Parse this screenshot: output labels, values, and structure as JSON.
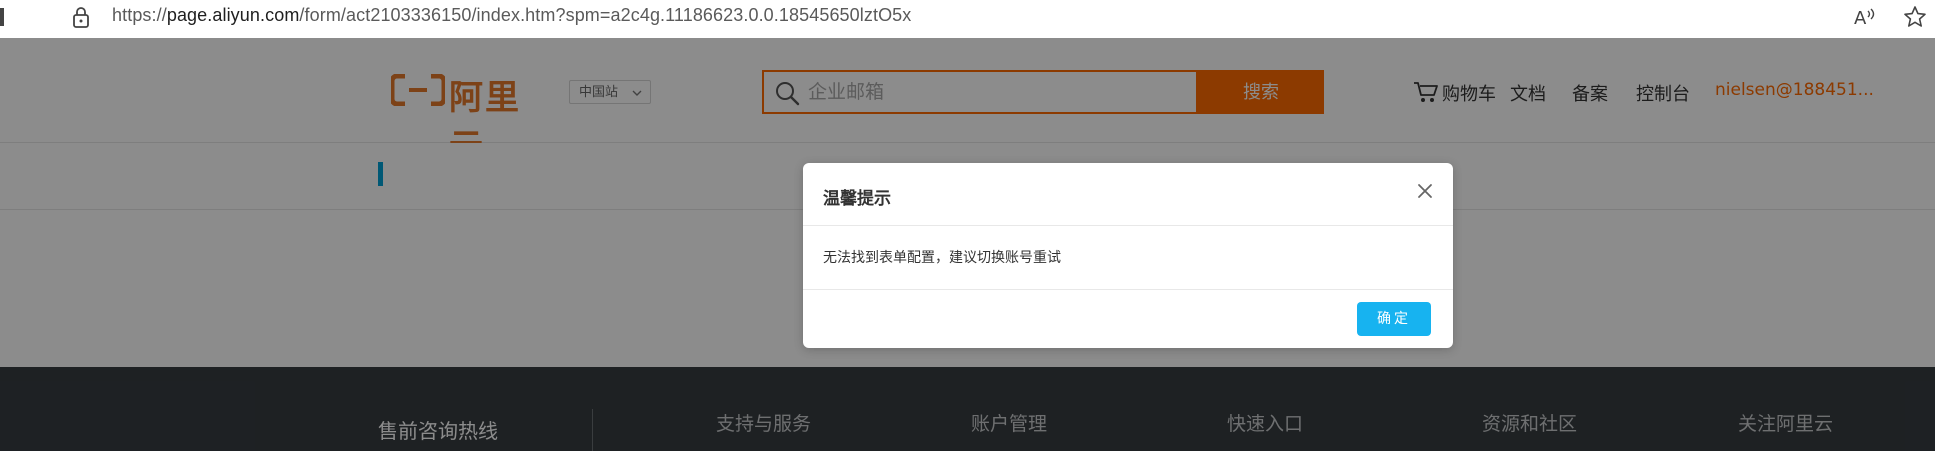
{
  "browser": {
    "url_prefix": "https://",
    "url_host": "page.aliyun.com",
    "url_path": "/form/act2103336150/index.htm?spm=a2c4g.11186623.0.0.18545650lztO5x",
    "read_aloud_text": "A",
    "icons": [
      "lock-icon",
      "read-aloud-icon",
      "favorite-star-icon"
    ]
  },
  "header": {
    "logo_text": "阿里云",
    "region_label": "中国站",
    "search_placeholder": "企业邮箱",
    "search_button": "搜索",
    "nav": {
      "cart": "购物车",
      "docs": "文档",
      "beian": "备案",
      "console": "控制台",
      "user": "nielsen@188451..."
    },
    "colors": {
      "brand": "#ff6a00",
      "logo": "#e3782b",
      "accent": "#00a1d6"
    }
  },
  "footer": {
    "hotline": "售前咨询热线",
    "columns": [
      "支持与服务",
      "账户管理",
      "快速入口",
      "资源和社区",
      "关注阿里云"
    ]
  },
  "modal": {
    "title": "温馨提示",
    "message": "无法找到表单配置，建议切换账号重试",
    "confirm": "确定",
    "confirm_color": "#17b3f0"
  }
}
